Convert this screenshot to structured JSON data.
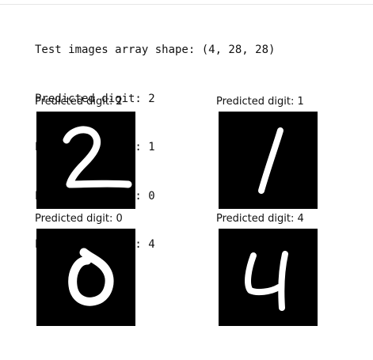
{
  "output": {
    "lines": [
      "Test images array shape: (4, 28, 28)",
      "Predicted digit: 2",
      "Predicted digit: 1",
      "Predicted digit: 0",
      "Predicted digit: 4"
    ]
  },
  "figure": {
    "panels": [
      {
        "title": "Predicted digit: 2",
        "digit": "2"
      },
      {
        "title": "Predicted digit: 1",
        "digit": "1"
      },
      {
        "title": "Predicted digit: 0",
        "digit": "0"
      },
      {
        "title": "Predicted digit: 4",
        "digit": "4"
      }
    ],
    "colors": {
      "image_background": "#000000",
      "stroke": "#ffffff"
    }
  }
}
